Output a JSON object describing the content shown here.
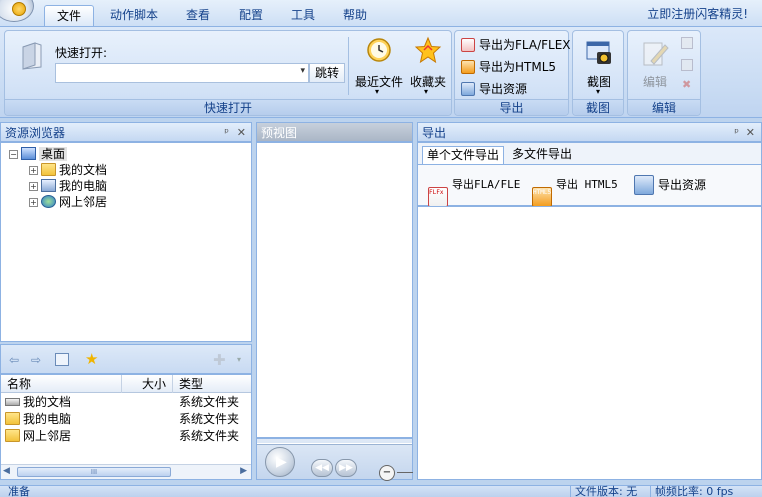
{
  "tabs": [
    {
      "label": "文件",
      "active": true
    },
    {
      "label": "动作脚本",
      "active": false
    },
    {
      "label": "查看",
      "active": false
    },
    {
      "label": "配置",
      "active": false
    },
    {
      "label": "工具",
      "active": false
    },
    {
      "label": "帮助",
      "active": false
    }
  ],
  "register_link": "立即注册闪客精灵!",
  "ribbon": {
    "quick_open": {
      "label": "快速打开:",
      "input_value": "",
      "go_button": "跳转",
      "recent_files": "最近文件",
      "favorites": "收藏夹",
      "group_label": "快速打开"
    },
    "export": {
      "fla": "导出为FLA/FLEX",
      "html5": "导出为HTML5",
      "resources": "导出资源",
      "group_label": "导出"
    },
    "screenshot": {
      "button": "截图",
      "group_label": "截图"
    },
    "edit": {
      "button": "编辑",
      "group_label": "编辑"
    }
  },
  "resource_browser": {
    "title": "资源浏览器",
    "tree": {
      "root": "桌面",
      "children": [
        "我的文档",
        "我的电脑",
        "网上邻居"
      ]
    },
    "columns": {
      "name": "名称",
      "size": "大小",
      "type": "类型"
    },
    "rows": [
      {
        "name": "我的文档",
        "size": "",
        "type": "系统文件夹"
      },
      {
        "name": "我的电脑",
        "size": "",
        "type": "系统文件夹"
      },
      {
        "name": "网上邻居",
        "size": "",
        "type": "系统文件夹"
      }
    ],
    "scroll_glyph": "III"
  },
  "preview": {
    "title": "预视图"
  },
  "export_pane": {
    "title": "导出",
    "tabs": [
      "单个文件导出",
      "多文件导出"
    ],
    "buttons": {
      "fla": "导出FLA/FLE",
      "html5": "导出 HTML5",
      "resources": "导出资源"
    },
    "icon_text": {
      "fla": "FLFx",
      "html5": "HTML5"
    }
  },
  "status": {
    "left": "准备",
    "version": "文件版本: 无",
    "framerate": "帧频比率: 0 fps"
  },
  "pane_controls": {
    "pin": "ᵖ",
    "close": "✕"
  },
  "colors": {
    "accent_text": "#15428b",
    "border": "#8db2e3",
    "ribbon_bg": "#c8dbf3"
  }
}
